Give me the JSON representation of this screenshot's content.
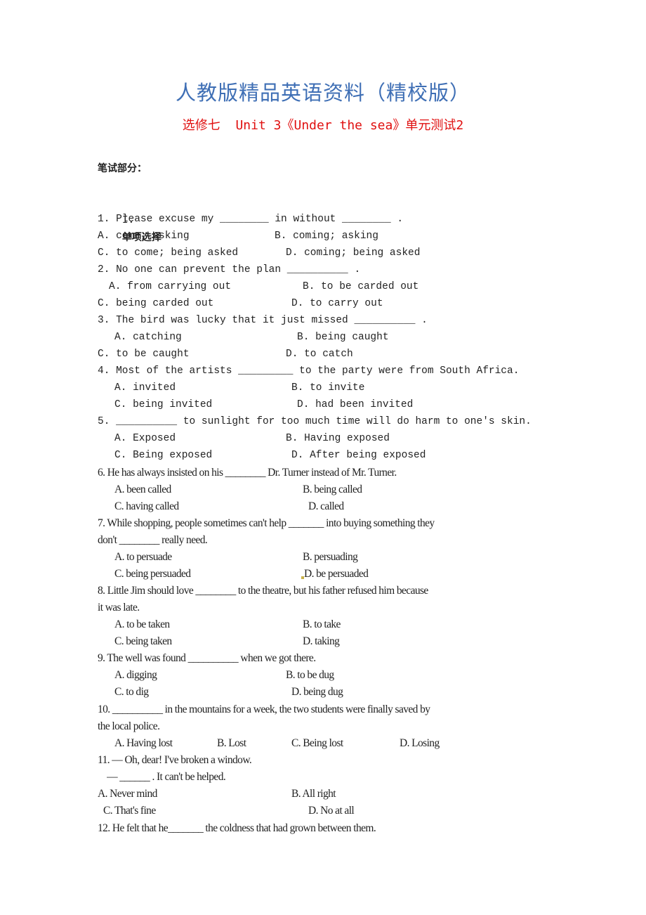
{
  "header": {
    "title": "人教版精品英语资料（精校版）",
    "subtitle": "选修七  Unit 3《Under the sea》单元测试2"
  },
  "section_label": "笔试部分：",
  "part": {
    "number": "I.",
    "name": "单项选择"
  },
  "questions": [
    {
      "stem": [
        "1. Please excuse my ________ in without ________ ."
      ],
      "options": {
        "A": "A. come; asking",
        "B": "B. coming; asking",
        "C": "C. to come; being asked",
        "D": "D. coming; being asked"
      }
    },
    {
      "stem": [
        "2. No one can prevent the plan __________ ."
      ],
      "options": {
        "A": "A. from carrying out",
        "B": "B. to be carded out",
        "C": "C. being carded out",
        "D": "D. to carry out"
      }
    },
    {
      "stem": [
        "3. The bird was lucky that it just missed __________ ."
      ],
      "options": {
        "A": "A. catching",
        "B": "B. being caught",
        "C": "C. to be caught",
        "D": "D. to catch"
      }
    },
    {
      "stem": [
        "4. Most of the artists _________ to the party were from South Africa."
      ],
      "options": {
        "A": "A. invited",
        "B": "B. to invite",
        "C": "C. being invited",
        "D": "D. had been invited"
      }
    },
    {
      "stem": [
        "5. __________ to sunlight for too much time will do harm to one's skin."
      ],
      "options": {
        "A": "A. Exposed",
        "B": "B. Having exposed",
        "C": "C. Being exposed",
        "D": "D. After being exposed"
      }
    },
    {
      "stem": [
        "6. He has always insisted on his ________ Dr. Turner instead of Mr. Turner."
      ],
      "options": {
        "A": "A. been called",
        "B": "B. being called",
        "C": "C. having called",
        "D": "D. called"
      }
    },
    {
      "stem": [
        "7. While shopping, people sometimes can't help _______ into buying something they",
        "don't ________ really need."
      ],
      "options": {
        "A": "A. to persuade",
        "B": "B. persuading",
        "C": "C. being persuaded",
        "D": "D. be persuaded"
      }
    },
    {
      "stem": [
        "8. Little Jim should love ________ to the theatre, but his father refused him because",
        "it was late."
      ],
      "options": {
        "A": "A. to be taken",
        "B": "B. to take",
        "C": "C. being taken",
        "D": "D. taking"
      }
    },
    {
      "stem": [
        "9. The well was found __________ when we got there."
      ],
      "options": {
        "A": "A. digging",
        "B": "B. to be dug",
        "C": "C. to dig",
        "D": "D. being dug"
      }
    },
    {
      "stem": [
        "10. __________ in the mountains for a week, the two students were finally saved by",
        "the local police."
      ],
      "options": {
        "A": "A. Having lost",
        "B": "B. Lost",
        "C": "C. Being lost",
        "D": "D. Losing"
      }
    },
    {
      "stem": [
        "11. — Oh, dear! I've broken a window.",
        "    — ______ . It can't be helped."
      ],
      "options": {
        "A": "A. Never mind",
        "B": "B. All right",
        "C": "C. That's fine",
        "D": "D. No at all"
      }
    },
    {
      "stem": [
        "12. He felt that he_______ the coldness that had grown between them."
      ]
    }
  ]
}
